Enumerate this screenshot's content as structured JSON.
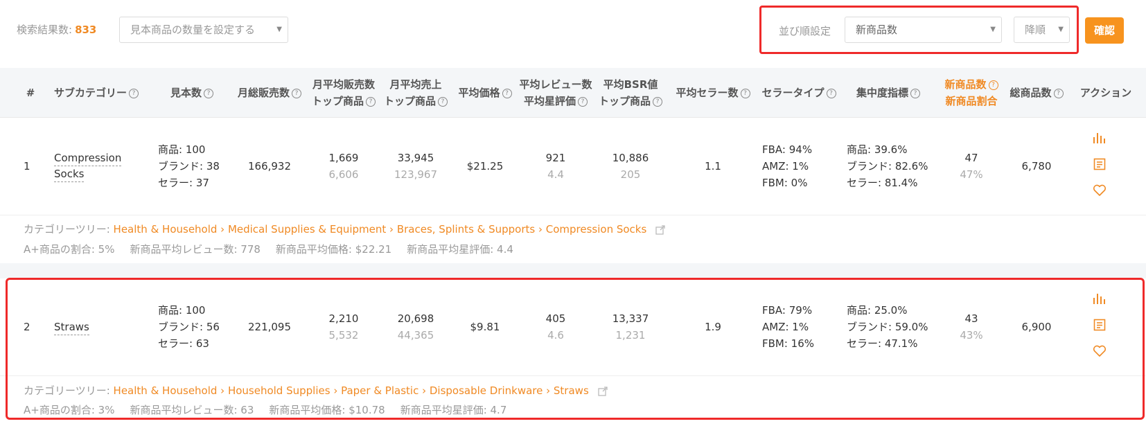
{
  "toolbar": {
    "result_label": "検索結果数:",
    "result_count": "833",
    "sample_placeholder": "見本商品の数量を設定する",
    "sort_label": "並び順設定",
    "sort_value": "新商品数",
    "order_value": "降順",
    "confirm_label": "確認"
  },
  "columns": {
    "index": "#",
    "subcategory": "サブカテゴリー",
    "samples": "見本数",
    "monthly_sales": "月総販売数",
    "avg_sales_1": "月平均販売数",
    "avg_sales_2": "トップ商品",
    "avg_revenue_1": "月平均売上",
    "avg_revenue_2": "トップ商品",
    "avg_price": "平均価格",
    "reviews_1": "平均レビュー数",
    "reviews_2": "平均星評価",
    "bsr_1": "平均BSR値",
    "bsr_2": "トップ商品",
    "sellers": "平均セラー数",
    "seller_type": "セラータイプ",
    "concentration": "集中度指標",
    "new_1": "新商品数",
    "new_2": "新商品割合",
    "total": "総商品数",
    "action": "アクション"
  },
  "rows": [
    {
      "index": "1",
      "name_1": "Compression",
      "name_2": "Socks",
      "samples_product": "商品: 100",
      "samples_brand": "ブランド: 38",
      "samples_seller": "セラー: 37",
      "monthly_sales": "166,932",
      "avg_sales": "1,669",
      "avg_sales_top": "6,606",
      "avg_revenue": "33,945",
      "avg_revenue_top": "123,967",
      "avg_price": "$21.25",
      "reviews": "921",
      "rating": "4.4",
      "bsr": "10,886",
      "bsr_top": "205",
      "sellers": "1.1",
      "fba": "FBA: 94%",
      "amz": "AMZ: 1%",
      "fbm": "FBM: 0%",
      "conc_product": "商品: 39.6%",
      "conc_brand": "ブランド: 82.6%",
      "conc_seller": "セラー: 81.4%",
      "new_count": "47",
      "new_ratio": "47%",
      "total": "6,780",
      "tree_label": "カテゴリーツリー:",
      "tree_path": "Health & Household › Medical Supplies & Equipment › Braces, Splints & Supports › Compression Socks",
      "aplus": "A+商品の割合: 5%",
      "new_reviews": "新商品平均レビュー数: 778",
      "new_price": "新商品平均価格: $22.21",
      "new_rating": "新商品平均星評価: 4.4"
    },
    {
      "index": "2",
      "name_1": "Straws",
      "name_2": "",
      "samples_product": "商品: 100",
      "samples_brand": "ブランド: 56",
      "samples_seller": "セラー: 63",
      "monthly_sales": "221,095",
      "avg_sales": "2,210",
      "avg_sales_top": "5,532",
      "avg_revenue": "20,698",
      "avg_revenue_top": "44,365",
      "avg_price": "$9.81",
      "reviews": "405",
      "rating": "4.6",
      "bsr": "13,337",
      "bsr_top": "1,231",
      "sellers": "1.9",
      "fba": "FBA: 79%",
      "amz": "AMZ: 1%",
      "fbm": "FBM: 16%",
      "conc_product": "商品: 25.0%",
      "conc_brand": "ブランド: 59.0%",
      "conc_seller": "セラー: 47.1%",
      "new_count": "43",
      "new_ratio": "43%",
      "total": "6,900",
      "tree_label": "カテゴリーツリー:",
      "tree_path": "Health & Household › Household Supplies › Paper & Plastic › Disposable Drinkware › Straws",
      "aplus": "A+商品の割合: 3%",
      "new_reviews": "新商品平均レビュー数: 63",
      "new_price": "新商品平均価格: $10.78",
      "new_rating": "新商品平均星評価: 4.7"
    }
  ],
  "icons": {
    "chart": "bar-chart-icon",
    "details": "document-icon",
    "favorite": "heart-icon",
    "help": "question-icon",
    "external": "external-link-icon"
  },
  "colors": {
    "accent": "#f08a24",
    "button": "#f7931e",
    "highlight": "#ef2a2a"
  }
}
